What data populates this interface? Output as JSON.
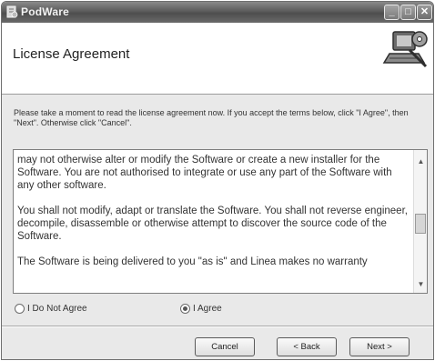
{
  "window": {
    "title": "PodWare",
    "app_icon": "installer-icon",
    "controls": {
      "minimize": "_",
      "maximize": "□",
      "close": "✕"
    }
  },
  "header": {
    "title": "License Agreement",
    "art_icon": "computer-setup-icon"
  },
  "intro": "Please take a moment to read the license agreement now. If you accept the terms below, click \"I Agree\", then \"Next\". Otherwise click \"Cancel\".",
  "license": {
    "paragraphs": [
      "may not otherwise alter or modify the Software or create a new installer for the Software. You are not authorised to integrate or use any part of the Software with any other software.",
      "You shall not modify, adapt or translate the Software. You shall not reverse engineer, decompile, disassemble or otherwise attempt to discover the source code of the Software.",
      "The Software is being delivered to you \"as is\" and Linea makes no warranty"
    ],
    "scroll_position": 0.5
  },
  "radios": {
    "disagree_label": "I Do Not Agree",
    "agree_label": "I Agree",
    "selected": "agree"
  },
  "buttons": {
    "cancel": "Cancel",
    "back": "< Back",
    "next": "Next >"
  }
}
